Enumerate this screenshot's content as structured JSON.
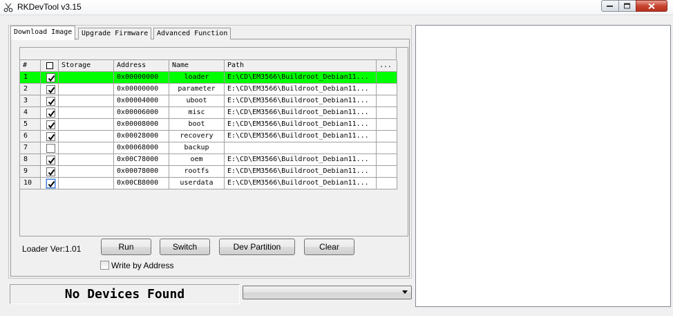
{
  "window": {
    "title": "RKDevTool v3.15",
    "icon": "scissors-icon"
  },
  "tabs": [
    {
      "label": "Download Image",
      "active": true
    },
    {
      "label": "Upgrade Firmware",
      "active": false
    },
    {
      "label": "Advanced Function",
      "active": false
    }
  ],
  "table": {
    "headers": {
      "num": "#",
      "check": "",
      "storage": "Storage",
      "address": "Address",
      "name": "Name",
      "path": "Path",
      "more": "..."
    },
    "rows": [
      {
        "num": "1",
        "checked": true,
        "storage": "",
        "address": "0x00000000",
        "name": "loader",
        "path": "E:\\CD\\EM3566\\Buildroot_Debian11...",
        "highlight": true
      },
      {
        "num": "2",
        "checked": true,
        "storage": "",
        "address": "0x00000000",
        "name": "parameter",
        "path": "E:\\CD\\EM3566\\Buildroot_Debian11...",
        "highlight": false
      },
      {
        "num": "3",
        "checked": true,
        "storage": "",
        "address": "0x00004000",
        "name": "uboot",
        "path": "E:\\CD\\EM3566\\Buildroot_Debian11...",
        "highlight": false
      },
      {
        "num": "4",
        "checked": true,
        "storage": "",
        "address": "0x00006000",
        "name": "misc",
        "path": "E:\\CD\\EM3566\\Buildroot_Debian11...",
        "highlight": false
      },
      {
        "num": "5",
        "checked": true,
        "storage": "",
        "address": "0x00008000",
        "name": "boot",
        "path": "E:\\CD\\EM3566\\Buildroot_Debian11...",
        "highlight": false
      },
      {
        "num": "6",
        "checked": true,
        "storage": "",
        "address": "0x00028000",
        "name": "recovery",
        "path": "E:\\CD\\EM3566\\Buildroot_Debian11...",
        "highlight": false
      },
      {
        "num": "7",
        "checked": false,
        "storage": "",
        "address": "0x00068000",
        "name": "backup",
        "path": "",
        "highlight": false
      },
      {
        "num": "8",
        "checked": true,
        "storage": "",
        "address": "0x00C78000",
        "name": "oem",
        "path": "E:\\CD\\EM3566\\Buildroot_Debian11...",
        "highlight": false
      },
      {
        "num": "9",
        "checked": true,
        "storage": "",
        "address": "0x00078000",
        "name": "rootfs",
        "path": "E:\\CD\\EM3566\\Buildroot_Debian11...",
        "highlight": false
      },
      {
        "num": "10",
        "checked": true,
        "storage": "",
        "address": "0x00CB8000",
        "name": "userdata",
        "path": "E:\\CD\\EM3566\\Buildroot_Debian11...",
        "highlight": false
      }
    ]
  },
  "controls": {
    "loader_ver": "Loader Ver:1.01",
    "run_label": "Run",
    "switch_label": "Switch",
    "dev_partition_label": "Dev Partition",
    "clear_label": "Clear",
    "write_by_address_label": "Write by Address",
    "write_by_address_checked": false
  },
  "status": {
    "text": "No Devices Found",
    "combo_value": ""
  },
  "colors": {
    "highlight": "#00ff00"
  }
}
